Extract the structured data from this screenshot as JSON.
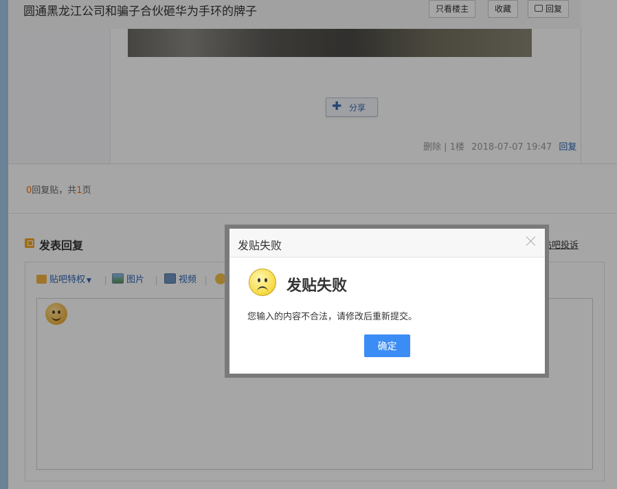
{
  "thread": {
    "title": "圆通黑龙江公司和骗子合伙砸华为手环的牌子",
    "buttons": {
      "only_op": "只看楼主",
      "favorite": "收藏",
      "reply": "回复"
    }
  },
  "post": {
    "share_label": "分享",
    "meta": {
      "delete": "删除",
      "separator": "|",
      "floor": "1楼",
      "date": "2018-07-07 19:47",
      "reply": "回复"
    }
  },
  "reply_summary": {
    "count": "0",
    "middle": "回复贴，共",
    "pages": "1",
    "suffix": "页"
  },
  "compose": {
    "title": "发表回复",
    "complain": "贴吧投诉",
    "toolbar": {
      "privilege": "贴吧特权",
      "image": "图片",
      "video": "视频"
    }
  },
  "dialog": {
    "title": "发贴失败",
    "heading": "发贴失败",
    "message": "您输入的内容不合法，请修改后重新提交。",
    "confirm": "确定"
  },
  "colors": {
    "accent": "#3b8cf5",
    "link": "#2d64b3",
    "highlight": "#ff6600"
  }
}
